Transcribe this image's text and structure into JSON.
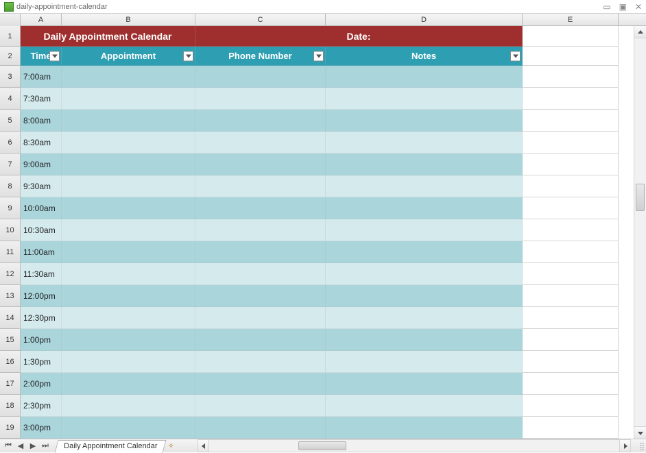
{
  "window": {
    "title": "daily-appointment-calendar"
  },
  "columns": {
    "A": "A",
    "B": "B",
    "C": "C",
    "D": "D",
    "E": "E"
  },
  "title_row": {
    "left": "Daily Appointment Calendar",
    "right": "Date:"
  },
  "headers": {
    "time": "Time",
    "appointment": "Appointment",
    "phone": "Phone Number",
    "notes": "Notes"
  },
  "rows": [
    {
      "num": "1"
    },
    {
      "num": "2"
    },
    {
      "num": "3",
      "time": "7:00am"
    },
    {
      "num": "4",
      "time": "7:30am"
    },
    {
      "num": "5",
      "time": "8:00am"
    },
    {
      "num": "6",
      "time": "8:30am"
    },
    {
      "num": "7",
      "time": "9:00am"
    },
    {
      "num": "8",
      "time": "9:30am"
    },
    {
      "num": "9",
      "time": "10:00am"
    },
    {
      "num": "10",
      "time": "10:30am"
    },
    {
      "num": "11",
      "time": "11:00am"
    },
    {
      "num": "12",
      "time": "11:30am"
    },
    {
      "num": "13",
      "time": "12:00pm"
    },
    {
      "num": "14",
      "time": "12:30pm"
    },
    {
      "num": "15",
      "time": "1:00pm"
    },
    {
      "num": "16",
      "time": "1:30pm"
    },
    {
      "num": "17",
      "time": "2:00pm"
    },
    {
      "num": "18",
      "time": "2:30pm"
    },
    {
      "num": "19",
      "time": "3:00pm"
    }
  ],
  "sheet_tab": "Daily Appointment Calendar",
  "colors": {
    "title_bg": "#9f2f2e",
    "header_bg": "#2e9fb3",
    "band_odd": "#a9d5db",
    "band_even": "#d4eaed"
  }
}
